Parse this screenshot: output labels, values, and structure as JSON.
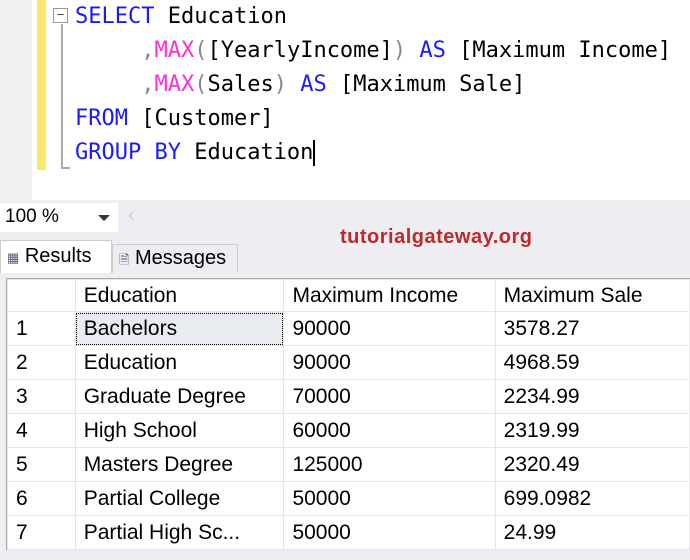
{
  "editor": {
    "lines": [
      {
        "parts": [
          [
            "kw",
            "SELECT"
          ],
          [
            "",
            ""
          ],
          [
            "",
            " Education"
          ]
        ]
      },
      {
        "parts": [
          [
            "",
            "     "
          ],
          [
            "gr",
            ","
          ],
          [
            "fn",
            "MAX"
          ],
          [
            "gr",
            "("
          ],
          [
            "",
            "[YearlyIncome]"
          ],
          [
            "gr",
            ")"
          ],
          [
            "",
            " "
          ],
          [
            "kw",
            "AS"
          ],
          [
            "",
            " [Maximum Income]"
          ]
        ]
      },
      {
        "parts": [
          [
            "",
            "     "
          ],
          [
            "gr",
            ","
          ],
          [
            "fn",
            "MAX"
          ],
          [
            "gr",
            "("
          ],
          [
            "",
            "Sales"
          ],
          [
            "gr",
            ")"
          ],
          [
            "",
            " "
          ],
          [
            "kw",
            "AS"
          ],
          [
            "",
            " [Maximum Sale]"
          ]
        ]
      },
      {
        "parts": [
          [
            "kw",
            "FROM"
          ],
          [
            "",
            " [Customer]"
          ]
        ]
      },
      {
        "parts": [
          [
            "kw",
            "GROUP BY"
          ],
          [
            "",
            " Education"
          ]
        ]
      }
    ]
  },
  "zoom": {
    "value": "100 %"
  },
  "watermark": "tutorialgateway.org",
  "tabs": {
    "results": "Results",
    "messages": "Messages"
  },
  "grid": {
    "columns": [
      "",
      "Education",
      "Maximum Income",
      "Maximum Sale"
    ],
    "rows": [
      [
        "1",
        "Bachelors",
        "90000",
        "3578.27"
      ],
      [
        "2",
        "Education",
        "90000",
        "4968.59"
      ],
      [
        "3",
        "Graduate Degree",
        "70000",
        "2234.99"
      ],
      [
        "4",
        "High School",
        "60000",
        "2319.99"
      ],
      [
        "5",
        "Masters Degree",
        "125000",
        "2320.49"
      ],
      [
        "6",
        "Partial College",
        "50000",
        "699.0982"
      ],
      [
        "7",
        "Partial High Sc...",
        "50000",
        "24.99"
      ]
    ]
  }
}
